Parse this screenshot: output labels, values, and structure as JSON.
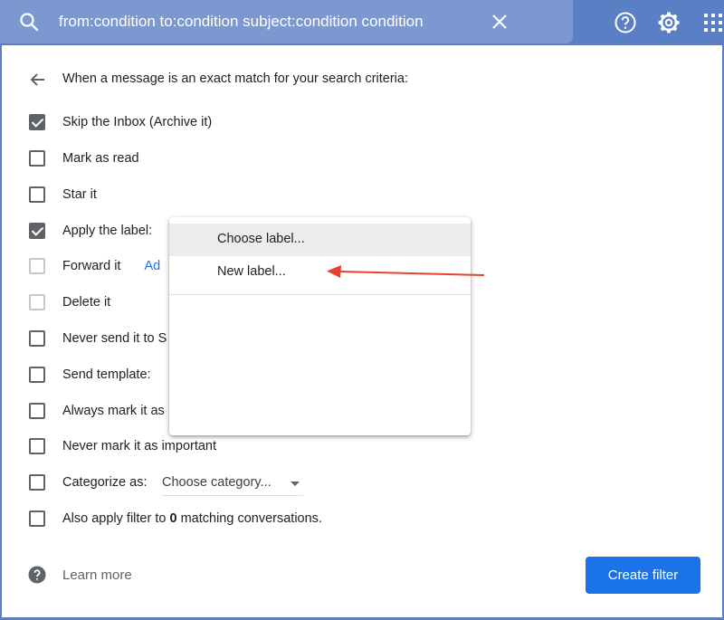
{
  "search": {
    "query": "from:condition to:condition subject:condition condition"
  },
  "header_icons": [
    "search-icon",
    "close-icon",
    "help-icon",
    "settings-icon",
    "apps-icon"
  ],
  "filter": {
    "heading": "When a message is an exact match for your search criteria:",
    "options": [
      {
        "label": "Skip the Inbox (Archive it)",
        "checked": true
      },
      {
        "label": "Mark as read",
        "checked": false
      },
      {
        "label": "Star it",
        "checked": false
      },
      {
        "label": "Apply the label:",
        "checked": true
      },
      {
        "label": "Forward it",
        "checked": false,
        "disabled": true,
        "link": "Ad"
      },
      {
        "label": "Delete it",
        "checked": false,
        "disabled": true
      },
      {
        "label": "Never send it to S",
        "checked": false
      },
      {
        "label": "Send template:",
        "checked": false
      },
      {
        "label": "Always mark it as",
        "checked": false
      },
      {
        "label": "Never mark it as important",
        "checked": false
      },
      {
        "label": "Categorize as:",
        "checked": false,
        "select": "Choose category..."
      },
      {
        "label_prefix": "Also apply filter to ",
        "count": "0",
        "label_suffix": " matching conversations.",
        "checked": false
      }
    ],
    "learn_more": "Learn more",
    "create_button": "Create filter"
  },
  "label_dropdown": {
    "items": [
      "Choose label...",
      "New label..."
    ],
    "highlighted": "Choose label..."
  },
  "colors": {
    "header_bg": "#5b7fc4",
    "accent": "#1a73e8",
    "annotation_arrow": "#e8412f"
  }
}
